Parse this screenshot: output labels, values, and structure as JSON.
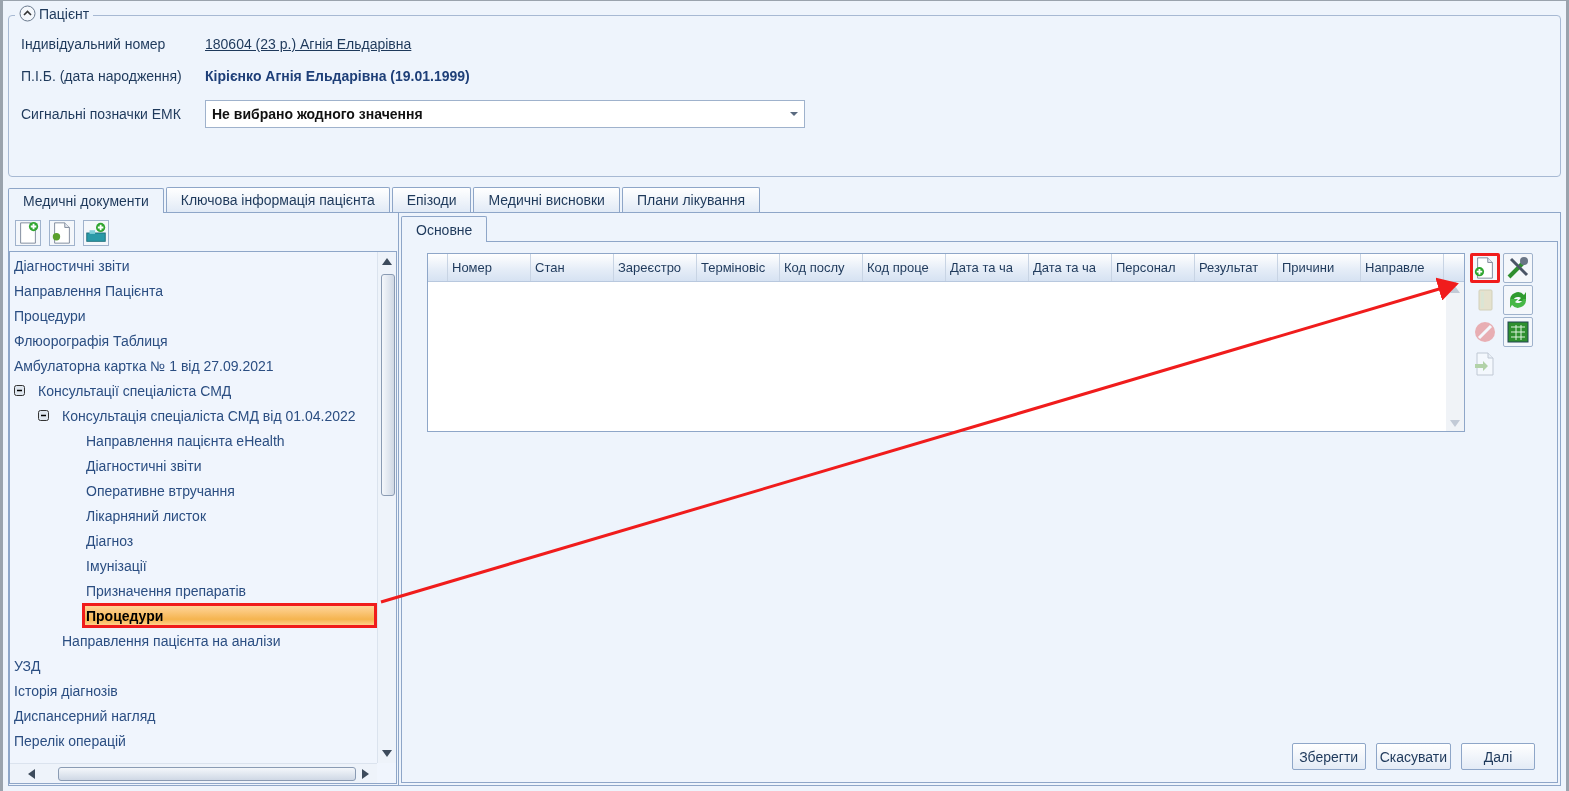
{
  "patient": {
    "title": "Пацієнт",
    "expanded": true,
    "fields": [
      {
        "label": "Індивідуальний номер",
        "value": "180604 (23 р.) Агнія Ельдарівна",
        "kind": "link"
      },
      {
        "label": "П.І.Б. (дата народження)",
        "value": "Кірієнко Агнія Ельдарівна (19.01.1999)",
        "kind": "bold"
      },
      {
        "label": "Сигнальні позначки ЕМК",
        "value": "Не вибрано жодного значення",
        "kind": "dropdown"
      }
    ]
  },
  "tabs": [
    {
      "label": "Медичні документи",
      "selected": true
    },
    {
      "label": "Ключова інформація пацієнта",
      "selected": false
    },
    {
      "label": "Епізоди",
      "selected": false
    },
    {
      "label": "Медичні висновки",
      "selected": false
    },
    {
      "label": "Плани лікування",
      "selected": false
    }
  ],
  "tree_toolbar": [
    {
      "kind": "new"
    },
    {
      "kind": "import"
    },
    {
      "kind": "add-tray"
    }
  ],
  "tree": [
    {
      "label": "Діагностичні звіти",
      "selected": false
    },
    {
      "label": "Направлення Пацієнта",
      "selected": false
    },
    {
      "label": "Процедури",
      "selected": false
    },
    {
      "label": "Флюорографія Таблиця",
      "selected": false
    },
    {
      "label": "Амбулаторна картка № 1 від 27.09.2021",
      "selected": false
    },
    {
      "label": "Консультації спеціаліста СМД",
      "selected": false,
      "expanded": true,
      "children": [
        {
          "label": "Консультація спеціаліста СМД від 01.04.2022",
          "selected": false,
          "expanded": true,
          "children": [
            {
              "label": "Направлення пацієнта eHealth",
              "selected": false
            },
            {
              "label": "Діагностичні звіти",
              "selected": false
            },
            {
              "label": "Оперативне втручання",
              "selected": false
            },
            {
              "label": "Лікарняний листок",
              "selected": false
            },
            {
              "label": "Діагноз",
              "selected": false
            },
            {
              "label": "Імунізації",
              "selected": false
            },
            {
              "label": "Призначення препаратів",
              "selected": false
            },
            {
              "label": "Процедури",
              "selected": true
            }
          ]
        },
        {
          "label": "Направлення пацієнта на аналізи",
          "selected": false
        }
      ]
    },
    {
      "label": "УЗД",
      "selected": false
    },
    {
      "label": "Історія діагнозів",
      "selected": false
    },
    {
      "label": "Диспансерний нагляд",
      "selected": false
    },
    {
      "label": "Перелік операцій",
      "selected": false
    }
  ],
  "subtabs": [
    {
      "label": "Основне",
      "selected": true
    }
  ],
  "grid": {
    "columns": [
      "Номер",
      "Стан",
      "Зареєстро",
      "Терміновіс",
      "Код послу",
      "Код проце",
      "Дата та ча",
      "Дата та ча",
      "Персонал",
      "Результат",
      "Причини",
      "Направле"
    ]
  },
  "tools": [
    {
      "kind": "add",
      "disabled": false,
      "highlighted": true
    },
    {
      "kind": "tools",
      "disabled": false,
      "highlighted": false
    },
    {
      "kind": "book",
      "disabled": true,
      "highlighted": false
    },
    {
      "kind": "refresh",
      "disabled": false,
      "highlighted": false
    },
    {
      "kind": "cancel",
      "disabled": true,
      "highlighted": false
    },
    {
      "kind": "table",
      "disabled": false,
      "highlighted": false
    },
    {
      "kind": "forward",
      "disabled": true,
      "highlighted": false
    }
  ],
  "buttons": [
    "Зберегти",
    "Скасувати",
    "Далі"
  ]
}
